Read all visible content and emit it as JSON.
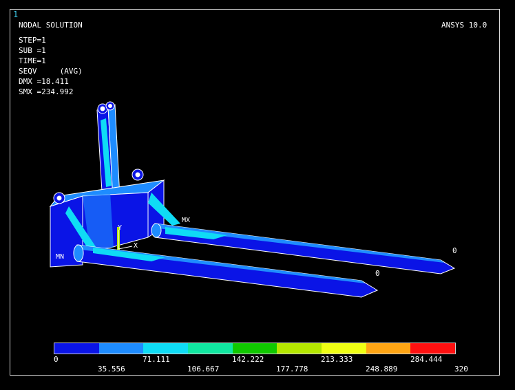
{
  "window_number": "1",
  "header": {
    "title": "NODAL SOLUTION",
    "version": "ANSYS 10.0"
  },
  "info": {
    "step": "STEP=1",
    "sub": "SUB =1",
    "time": "TIME=1",
    "seqv": "SEQV     (AVG)",
    "dmx": "DMX =18.411",
    "smx": "SMX =234.992"
  },
  "model_labels": {
    "mn": "MN",
    "mx": "MX",
    "axis_y": "Y",
    "axis_x": "X",
    "zero_1": "0",
    "zero_2": "0"
  },
  "legend": {
    "colors": [
      "#0a14e6",
      "#1e8cff",
      "#0fdcf5",
      "#10e6a0",
      "#10c800",
      "#b4e600",
      "#f0ff14",
      "#ffa514",
      "#ff1010"
    ],
    "labels_top": [
      "0",
      "71.111",
      "142.222",
      "213.333",
      "284.444"
    ],
    "labels_bottom": [
      "35.556",
      "106.667",
      "177.778",
      "248.889",
      "320"
    ]
  }
}
